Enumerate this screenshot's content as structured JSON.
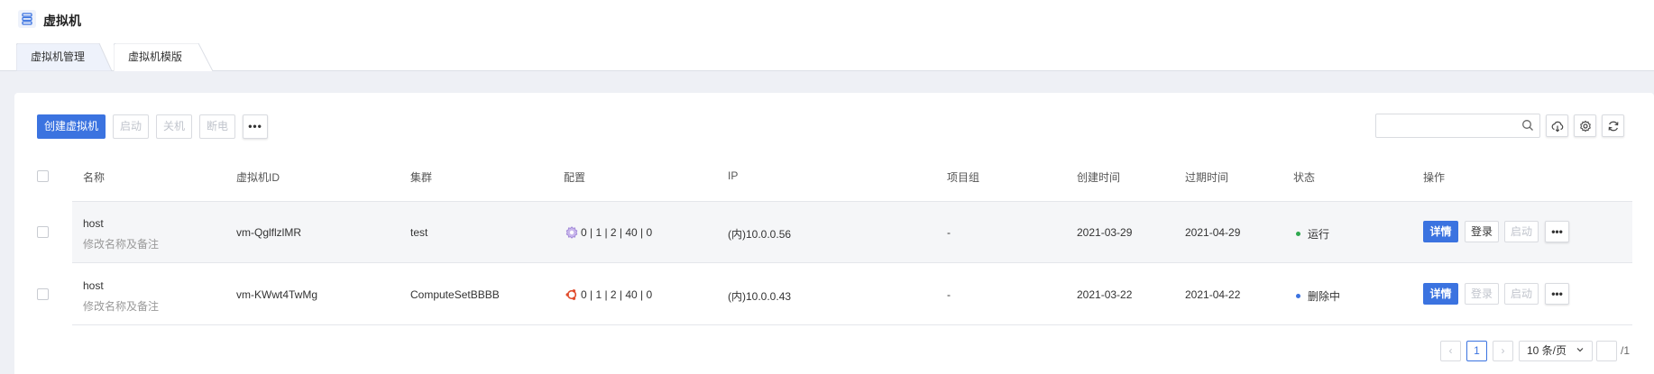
{
  "header": {
    "title": "虚拟机"
  },
  "tabs": [
    {
      "label": "虚拟机管理",
      "active": true
    },
    {
      "label": "虚拟机模版",
      "active": false
    }
  ],
  "toolbar": {
    "create_label": "创建虚拟机",
    "start_label": "启动",
    "shutdown_label": "关机",
    "poweroff_label": "断电",
    "more_label": "•••"
  },
  "search": {
    "placeholder": "",
    "value": ""
  },
  "table": {
    "columns": [
      "名称",
      "虚拟机ID",
      "集群",
      "配置",
      "IP",
      "项目组",
      "创建时间",
      "过期时间",
      "状态",
      "操作"
    ],
    "rows": [
      {
        "name": "host",
        "note": "修改名称及备注",
        "id": "vm-QglflzlMR",
        "cluster": "test",
        "os_icon": "gear-os-icon",
        "config": "0 | 1 | 2 | 40 | 0",
        "ip": "(内)10.0.0.56",
        "project": "-",
        "created": "2021-03-29",
        "expires": "2021-04-29",
        "status": "运行",
        "status_color": "#2fa84f",
        "actions": {
          "detail": "详情",
          "login": "登录",
          "start": "启动",
          "more": "•••"
        }
      },
      {
        "name": "host",
        "note": "修改名称及备注",
        "id": "vm-KWwt4TwMg",
        "cluster": "ComputeSetBBBB",
        "os_icon": "ubuntu-icon",
        "config": "0 | 1 | 2 | 40 | 0",
        "ip": "(内)10.0.0.43",
        "project": "-",
        "created": "2021-03-22",
        "expires": "2021-04-22",
        "status": "删除中",
        "status_color": "#3b73e0",
        "actions": {
          "detail": "详情",
          "login": "登录",
          "start": "启动",
          "more": "•••"
        }
      }
    ]
  },
  "pagination": {
    "prev": "‹",
    "current": "1",
    "next": "›",
    "page_size": "10 条/页",
    "jump_value": "",
    "total_pages": "/1"
  },
  "colors": {
    "primary": "#3b73e0",
    "running": "#2fa84f",
    "deleting": "#3b73e0",
    "ubuntu": "#e04a2b",
    "gear_os": "#9b7fd4"
  }
}
